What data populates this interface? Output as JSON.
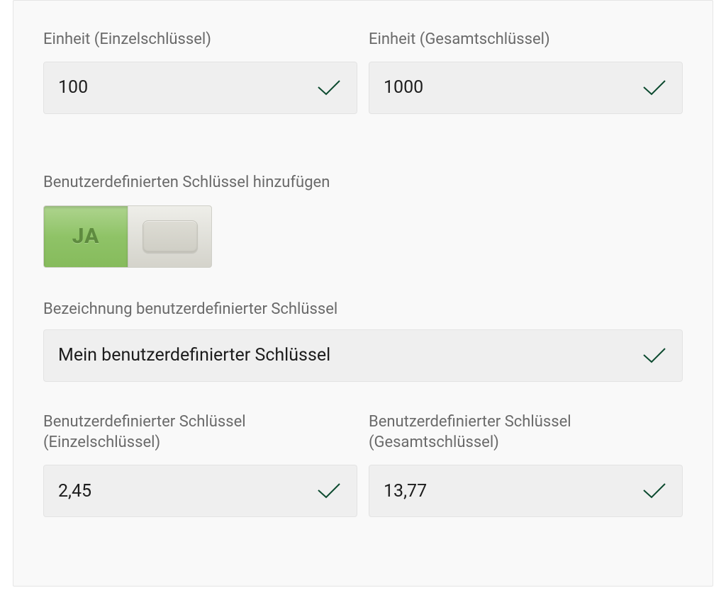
{
  "unit_single": {
    "label": "Einheit (Einzelschlüssel)",
    "value": "100"
  },
  "unit_total": {
    "label": "Einheit (Gesamtschlüssel)",
    "value": "1000"
  },
  "add_custom_key": {
    "label": "Benutzerdefinierten Schlüssel hinzufügen",
    "toggle_on_text": "JA",
    "state": "on"
  },
  "custom_key_name": {
    "label": "Bezeichnung benutzerdefinierter Schlüssel",
    "value": "Mein benutzerdefinierter Schlüssel"
  },
  "custom_key_single": {
    "label": "Benutzerdefinierter Schlüssel (Einzelschlüssel)",
    "value": "2,45"
  },
  "custom_key_total": {
    "label": "Benutzerdefinierter Schlüssel (Gesamtschlüssel)",
    "value": "13,77"
  },
  "colors": {
    "check_stroke": "#0c4a2f",
    "toggle_on_bg": "#8fc367"
  }
}
